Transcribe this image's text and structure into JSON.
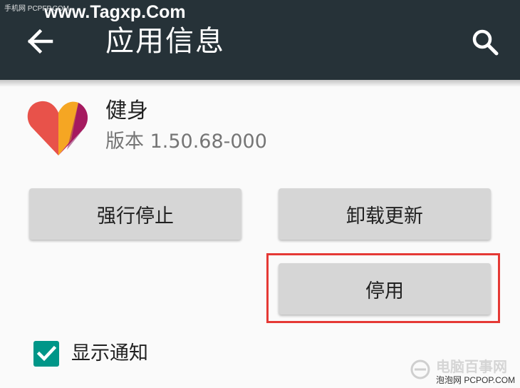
{
  "watermark": {
    "top_small": "手机网 PCPFP.COM",
    "top_brand": "www.Tagxp.Com",
    "bottom_brand": "电脑百事网",
    "bottom_text": "泡泡网 PCPOP.COM"
  },
  "appbar": {
    "title": "应用信息",
    "back_icon": "arrow-left-icon",
    "search_icon": "search-icon",
    "background": "#263238"
  },
  "app": {
    "name": "健身",
    "version": "版本 1.50.68-000",
    "icon": "google-fit-heart-icon"
  },
  "buttons": {
    "force_stop": "强行停止",
    "uninstall_updates": "卸载更新",
    "disable": "停用"
  },
  "notifications": {
    "label": "显示通知",
    "checked": true,
    "accent": "#009688"
  },
  "highlight": {
    "color": "#e53935",
    "target": "停用"
  }
}
